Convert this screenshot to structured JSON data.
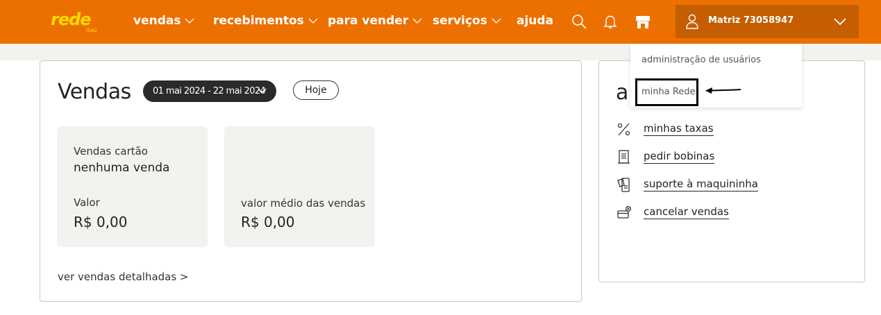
{
  "brand": {
    "name": "rede",
    "sub": "itaú",
    "accent": "#ec7000",
    "logo_color": "#ffdb00"
  },
  "nav": {
    "items": [
      {
        "label": "vendas",
        "has_menu": true
      },
      {
        "label": "recebimentos",
        "has_menu": true
      },
      {
        "label": "para vender",
        "has_menu": true
      },
      {
        "label": "serviços",
        "has_menu": true
      },
      {
        "label": "ajuda",
        "has_menu": false
      }
    ],
    "icons": [
      "search-icon",
      "bell-icon",
      "store-icon"
    ]
  },
  "account": {
    "name": "Matriz 73058947",
    "icon": "user-icon"
  },
  "account_menu": {
    "items": [
      {
        "label": "administração de usuários"
      },
      {
        "label": "minha Rede"
      }
    ]
  },
  "sales": {
    "title": "Vendas",
    "date_range": "01 mai 2024 - 22 mai 2024",
    "today_button": "Hoje",
    "card_sales": {
      "label": "Vendas cartão",
      "value": "nenhuma venda",
      "amount_label": "Valor",
      "amount": "R$ 0,00"
    },
    "card_average": {
      "label": "valor médio das vendas",
      "amount": "R$ 0,00"
    },
    "details_link": "ver vendas detalhadas >"
  },
  "shortcuts": {
    "title_visible": "a",
    "links": [
      {
        "label": "minhas taxas",
        "icon": "percent-icon"
      },
      {
        "label": "pedir bobinas",
        "icon": "receipt-icon"
      },
      {
        "label": "suporte à maquininha",
        "icon": "card-machine-icon"
      },
      {
        "label": "cancelar vendas",
        "icon": "cancel-card-icon"
      }
    ]
  }
}
